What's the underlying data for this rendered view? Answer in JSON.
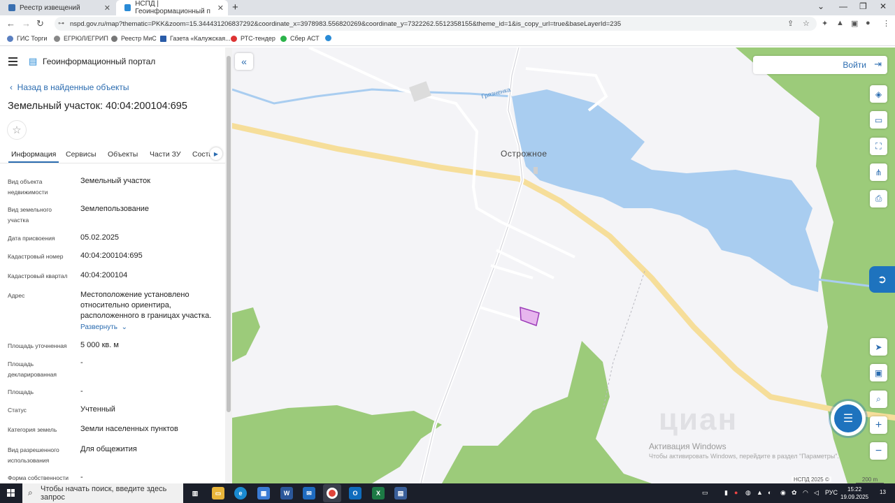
{
  "browser": {
    "tabs": [
      {
        "title": "Реестр извещений",
        "close": "✕"
      },
      {
        "title": "НСПД | Геоинформационный п",
        "close": "✕"
      }
    ],
    "new_tab": "+",
    "window_buttons": [
      "⌄",
      "—",
      "❐",
      "✕"
    ],
    "url": "nspd.gov.ru/map?thematic=PKK&zoom=15.344431206837292&coordinate_x=3978983.556820269&coordinate_y=7322262.5512358155&theme_id=1&is_copy_url=true&baseLayerId=235",
    "bookmarks": [
      "ГИС Торги",
      "ЕГРЮЛ/ЕГРИП",
      "Реестр МиС",
      "Газета «Калужская...",
      "РТС-тендер",
      "Сбер АСТ"
    ]
  },
  "panel": {
    "portal_title": "Геоинформационный портал",
    "back_link": "Назад в найденные объекты",
    "object_title": "Земельный участок: 40:04:200104:695",
    "tabs": [
      "Информация",
      "Сервисы",
      "Объекты",
      "Части ЗУ",
      "Соста"
    ],
    "rows": [
      {
        "label": "Вид объекта недвижимости",
        "value": "Земельный участок"
      },
      {
        "label": "Вид земельного участка",
        "value": "Землепользование"
      },
      {
        "label": "Дата присвоения",
        "value": "05.02.2025"
      },
      {
        "label": "Кадастровый номер",
        "value": "40:04:200104:695"
      },
      {
        "label": "Кадастровый квартал",
        "value": "40:04:200104"
      },
      {
        "label": "Адрес",
        "value": "Местоположение установлено относительно ориентира, расположенного в границах участка."
      },
      {
        "label": "Площадь уточненная",
        "value": "5 000 кв. м"
      },
      {
        "label": "Площадь декларированная",
        "value": "-"
      },
      {
        "label": "Площадь",
        "value": "-"
      },
      {
        "label": "Статус",
        "value": "Учтенный"
      },
      {
        "label": "Категория земель",
        "value": "Земли населенных пунктов"
      },
      {
        "label": "Вид разрешенного использования",
        "value": "Для общежития"
      },
      {
        "label": "Форма собственности",
        "value": "-"
      }
    ],
    "expand_label": "Развернуть"
  },
  "map": {
    "login": "Войти",
    "village": "Острожное",
    "river": "Грязненка",
    "watermark_title": "Активация Windows",
    "watermark_sub": "Чтобы активировать Windows, перейдите в раздел \"Параметры\".",
    "cian": "циан",
    "footer": "НСПД 2025 ©",
    "scale": "200 m",
    "colors": {
      "water": "#a9cdf0",
      "forest": "#9ccb7a",
      "road": "#f6de9a",
      "parcel": "#e7b6ee",
      "parcel_border": "#9b3bb8"
    }
  },
  "taskbar": {
    "search_placeholder": "Чтобы начать поиск, введите здесь запрос",
    "lang": "РУС",
    "time": "15:22",
    "date": "19.09.2025",
    "notif": "13"
  }
}
